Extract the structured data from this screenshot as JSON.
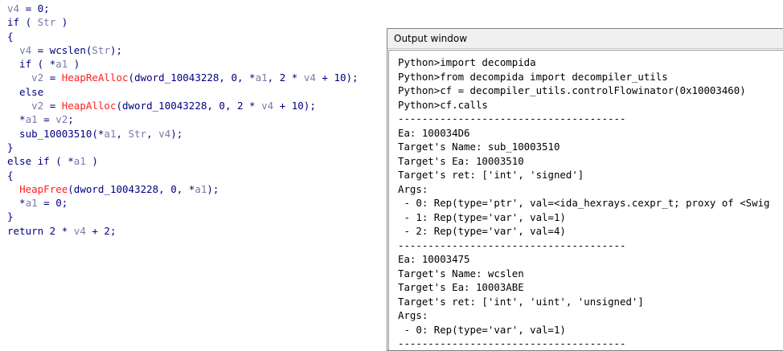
{
  "pseudocode": [
    [
      {
        "t": "v4",
        "c": "var"
      },
      {
        "t": " = 0;",
        "c": "op"
      }
    ],
    [
      {
        "t": "if",
        "c": "kw"
      },
      {
        "t": " ( ",
        "c": "op"
      },
      {
        "t": "Str",
        "c": "var"
      },
      {
        "t": " )",
        "c": "op"
      }
    ],
    [
      {
        "t": "{",
        "c": "op"
      }
    ],
    [
      {
        "t": "  ",
        "c": "op"
      },
      {
        "t": "v4",
        "c": "var"
      },
      {
        "t": " = wcslen(",
        "c": "op"
      },
      {
        "t": "Str",
        "c": "var"
      },
      {
        "t": ");",
        "c": "op"
      }
    ],
    [
      {
        "t": "  if",
        "c": "kw"
      },
      {
        "t": " ( *",
        "c": "op"
      },
      {
        "t": "a1",
        "c": "var"
      },
      {
        "t": " )",
        "c": "op"
      }
    ],
    [
      {
        "t": "    ",
        "c": "op"
      },
      {
        "t": "v2",
        "c": "var"
      },
      {
        "t": " = ",
        "c": "op"
      },
      {
        "t": "HeapReAlloc",
        "c": "fn"
      },
      {
        "t": "(dword_10043228, 0, *",
        "c": "op"
      },
      {
        "t": "a1",
        "c": "var"
      },
      {
        "t": ", 2 * ",
        "c": "op"
      },
      {
        "t": "v4",
        "c": "var"
      },
      {
        "t": " + 10);",
        "c": "op"
      }
    ],
    [
      {
        "t": "  else",
        "c": "kw"
      }
    ],
    [
      {
        "t": "    ",
        "c": "op"
      },
      {
        "t": "v2",
        "c": "var"
      },
      {
        "t": " = ",
        "c": "op"
      },
      {
        "t": "HeapAlloc",
        "c": "fn"
      },
      {
        "t": "(dword_10043228, 0, 2 * ",
        "c": "op"
      },
      {
        "t": "v4",
        "c": "var"
      },
      {
        "t": " + 10);",
        "c": "op"
      }
    ],
    [
      {
        "t": "  *",
        "c": "op"
      },
      {
        "t": "a1",
        "c": "var"
      },
      {
        "t": " = ",
        "c": "op"
      },
      {
        "t": "v2",
        "c": "var"
      },
      {
        "t": ";",
        "c": "op"
      }
    ],
    [
      {
        "t": "  sub_10003510(*",
        "c": "op"
      },
      {
        "t": "a1",
        "c": "var"
      },
      {
        "t": ", ",
        "c": "op"
      },
      {
        "t": "Str",
        "c": "var"
      },
      {
        "t": ", ",
        "c": "op"
      },
      {
        "t": "v4",
        "c": "var"
      },
      {
        "t": ");",
        "c": "op"
      }
    ],
    [
      {
        "t": "}",
        "c": "op"
      }
    ],
    [
      {
        "t": "else if",
        "c": "kw"
      },
      {
        "t": " ( *",
        "c": "op"
      },
      {
        "t": "a1",
        "c": "var"
      },
      {
        "t": " )",
        "c": "op"
      }
    ],
    [
      {
        "t": "{",
        "c": "op"
      }
    ],
    [
      {
        "t": "  ",
        "c": "op"
      },
      {
        "t": "HeapFree",
        "c": "fn"
      },
      {
        "t": "(dword_10043228, 0, *",
        "c": "op"
      },
      {
        "t": "a1",
        "c": "var"
      },
      {
        "t": ");",
        "c": "op"
      }
    ],
    [
      {
        "t": "  *",
        "c": "op"
      },
      {
        "t": "a1",
        "c": "var"
      },
      {
        "t": " = 0;",
        "c": "op"
      }
    ],
    [
      {
        "t": "}",
        "c": "op"
      }
    ],
    [
      {
        "t": "return",
        "c": "kw"
      },
      {
        "t": " 2 * ",
        "c": "op"
      },
      {
        "t": "v4",
        "c": "var"
      },
      {
        "t": " + 2;",
        "c": "op"
      }
    ]
  ],
  "output_window": {
    "title": "Output window",
    "lines": [
      "Python>import decompida",
      "Python>from decompida import decompiler_utils",
      "Python>cf = decompiler_utils.controlFlowinator(0x10003460)",
      "Python>cf.calls",
      "--------------------------------------",
      "Ea: 100034D6",
      "Target's Name: sub_10003510",
      "Target's Ea: 10003510",
      "Target's ret: ['int', 'signed']",
      "Args:",
      " - 0: Rep(type='ptr', val=<ida_hexrays.cexpr_t; proxy of <Swig",
      " - 1: Rep(type='var', val=1)",
      " - 2: Rep(type='var', val=4)",
      "--------------------------------------",
      "Ea: 10003475",
      "Target's Name: wcslen",
      "Target's Ea: 10003ABE",
      "Target's ret: ['int', 'uint', 'unsigned']",
      "Args:",
      " - 0: Rep(type='var', val=1)",
      "--------------------------------------"
    ]
  }
}
